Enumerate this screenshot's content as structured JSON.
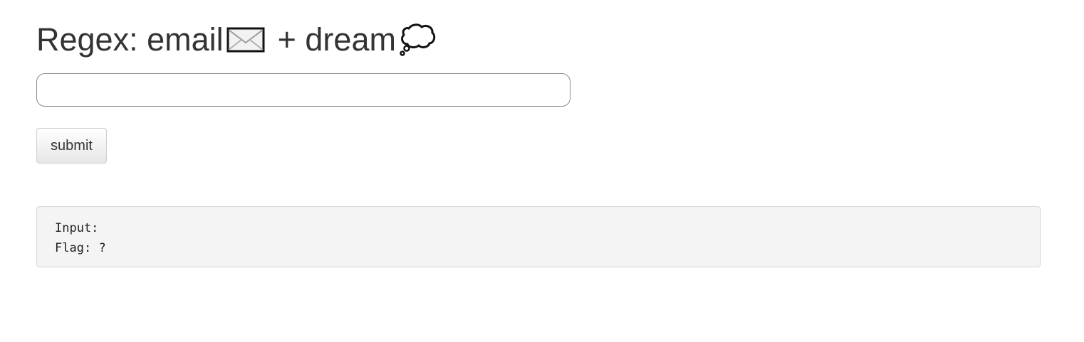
{
  "header": {
    "title_part1": "Regex: email",
    "title_part2": "+ dream",
    "icons": [
      "envelope-icon",
      "thought-balloon-icon"
    ]
  },
  "form": {
    "input_value": "",
    "input_placeholder": "",
    "submit_label": "submit"
  },
  "output": {
    "input_label": "Input:",
    "input_value": "",
    "flag_label": "Flag:",
    "flag_value": "?"
  },
  "colors": {
    "text": "#333333",
    "output_bg": "#f4f4f4",
    "output_border": "#d6d6d6"
  }
}
